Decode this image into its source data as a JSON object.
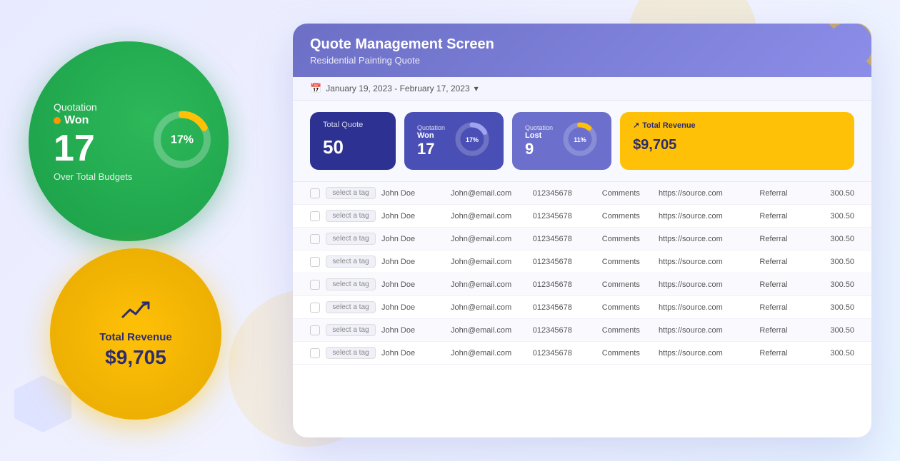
{
  "left": {
    "green_card": {
      "quotation_label": "Quotation",
      "won_label": "Won",
      "won_dot_color": "#ff9500",
      "big_number": "17",
      "over_budget_label": "Over Total Budgets",
      "donut_percent": 17,
      "donut_color": "#ffc107",
      "donut_bg": "rgba(255,255,255,0.3)"
    },
    "yellow_card": {
      "trend_icon": "↗",
      "revenue_label": "Total Revenue",
      "revenue_value": "$9,705"
    }
  },
  "right": {
    "screen_title": "Quote Management Screen",
    "screen_subtitle": "Residential Painting Quote",
    "date_range": "January 19, 2023 - February 17, 2023",
    "stats": {
      "total_quote_label": "Total Quote",
      "total_quote_value": "50",
      "won_q_label": "Quotation",
      "won_w_label": "Won",
      "won_number": "17",
      "won_percent": "17%",
      "won_percent_num": 17,
      "lost_q_label": "Quotation",
      "lost_w_label": "Lost",
      "lost_number": "9",
      "lost_percent": "11%",
      "lost_percent_num": 11,
      "revenue_label": "Total Revenue",
      "revenue_value": "$9,705",
      "revenue_trend_icon": "↗"
    },
    "table": {
      "rows": [
        {
          "tag": "select a tag",
          "name": "John Doe",
          "email": "John@email.com",
          "phone": "012345678",
          "comments": "Comments",
          "source": "https://source.com",
          "referral": "Referral",
          "amount": "300.50"
        },
        {
          "tag": "select a tag",
          "name": "John Doe",
          "email": "John@email.com",
          "phone": "012345678",
          "comments": "Comments",
          "source": "https://source.com",
          "referral": "Referral",
          "amount": "300.50"
        },
        {
          "tag": "select a tag",
          "name": "John Doe",
          "email": "John@email.com",
          "phone": "012345678",
          "comments": "Comments",
          "source": "https://source.com",
          "referral": "Referral",
          "amount": "300.50"
        },
        {
          "tag": "select a tag",
          "name": "John Doe",
          "email": "John@email.com",
          "phone": "012345678",
          "comments": "Comments",
          "source": "https://source.com",
          "referral": "Referral",
          "amount": "300.50"
        },
        {
          "tag": "select a tag",
          "name": "John Doe",
          "email": "John@email.com",
          "phone": "012345678",
          "comments": "Comments",
          "source": "https://source.com",
          "referral": "Referral",
          "amount": "300.50"
        },
        {
          "tag": "select a tag",
          "name": "John Doe",
          "email": "John@email.com",
          "phone": "012345678",
          "comments": "Comments",
          "source": "https://source.com",
          "referral": "Referral",
          "amount": "300.50"
        },
        {
          "tag": "select a tag",
          "name": "John Doe",
          "email": "John@email.com",
          "phone": "012345678",
          "comments": "Comments",
          "source": "https://source.com",
          "referral": "Referral",
          "amount": "300.50"
        },
        {
          "tag": "select a tag",
          "name": "John Doe",
          "email": "John@email.com",
          "phone": "012345678",
          "comments": "Comments",
          "source": "https://source.com",
          "referral": "Referral",
          "amount": "300.50"
        }
      ]
    }
  }
}
